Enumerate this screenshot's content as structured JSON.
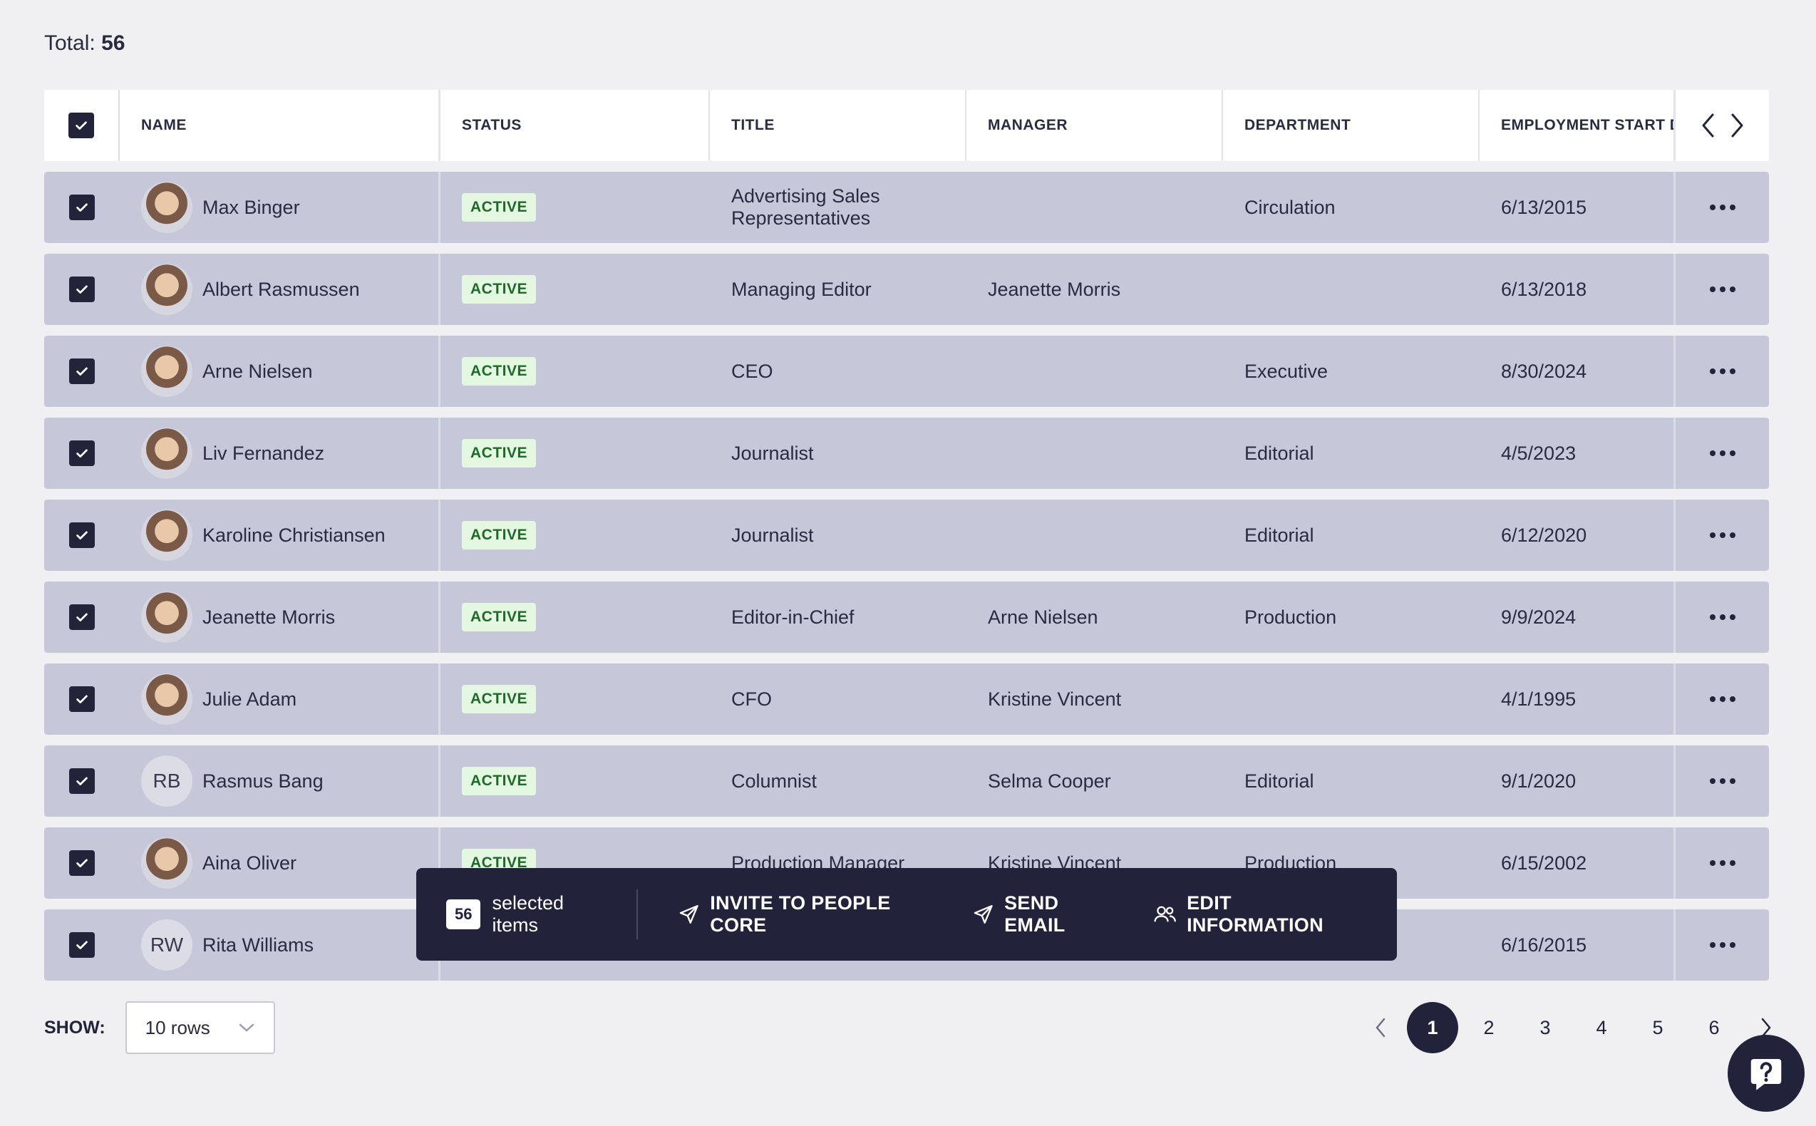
{
  "total": {
    "label": "Total:",
    "value": "56"
  },
  "table": {
    "headers": {
      "name": "NAME",
      "status": "STATUS",
      "title": "TITLE",
      "manager": "MANAGER",
      "department": "DEPARTMENT",
      "start_date": "EMPLOYMENT START D"
    },
    "rows": [
      {
        "name": "Max Binger",
        "avatar": "photo",
        "initials": "",
        "status": "ACTIVE",
        "title": "Advertising Sales Representatives",
        "manager": "",
        "department": "Circulation",
        "start_date": "6/13/2015"
      },
      {
        "name": "Albert Rasmussen",
        "avatar": "photo",
        "initials": "",
        "status": "ACTIVE",
        "title": "Managing Editor",
        "manager": "Jeanette Morris",
        "department": "",
        "start_date": "6/13/2018"
      },
      {
        "name": "Arne Nielsen",
        "avatar": "photo",
        "initials": "",
        "status": "ACTIVE",
        "title": "CEO",
        "manager": "",
        "department": "Executive",
        "start_date": "8/30/2024"
      },
      {
        "name": "Liv Fernandez",
        "avatar": "photo",
        "initials": "",
        "status": "ACTIVE",
        "title": "Journalist",
        "manager": "",
        "department": "Editorial",
        "start_date": "4/5/2023"
      },
      {
        "name": "Karoline Christiansen",
        "avatar": "photo",
        "initials": "",
        "status": "ACTIVE",
        "title": "Journalist",
        "manager": "",
        "department": "Editorial",
        "start_date": "6/12/2020"
      },
      {
        "name": "Jeanette Morris",
        "avatar": "photo",
        "initials": "",
        "status": "ACTIVE",
        "title": "Editor-in-Chief",
        "manager": "Arne Nielsen",
        "department": "Production",
        "start_date": "9/9/2024"
      },
      {
        "name": "Julie Adam",
        "avatar": "photo",
        "initials": "",
        "status": "ACTIVE",
        "title": "CFO",
        "manager": "Kristine Vincent",
        "department": "",
        "start_date": "4/1/1995"
      },
      {
        "name": "Rasmus Bang",
        "avatar": "initials",
        "initials": "RB",
        "status": "ACTIVE",
        "title": "Columnist",
        "manager": "Selma Cooper",
        "department": "Editorial",
        "start_date": "9/1/2020"
      },
      {
        "name": "Aina Oliver",
        "avatar": "photo",
        "initials": "",
        "status": "ACTIVE",
        "title": "Production Manager",
        "manager": "Kristine Vincent",
        "department": "Production",
        "start_date": "6/15/2002"
      },
      {
        "name": "Rita Williams",
        "avatar": "initials",
        "initials": "RW",
        "status": "",
        "title": "",
        "manager": "",
        "department": "",
        "start_date": "6/16/2015"
      }
    ]
  },
  "bulk_bar": {
    "count": "56",
    "selected_label": "selected items",
    "invite_label": "INVITE TO PEOPLE CORE",
    "email_label": "SEND EMAIL",
    "edit_label": "EDIT INFORMATION"
  },
  "footer": {
    "show_label": "SHOW:",
    "rows_value": "10 rows",
    "pages": [
      "1",
      "2",
      "3",
      "4",
      "5",
      "6"
    ],
    "current_page": "1"
  },
  "colors": {
    "row_bg": "#c7c7da",
    "header_bg": "#ffffff",
    "dark": "#22223a",
    "badge_bg": "#e4f7e1",
    "badge_text": "#1e6a2a",
    "page_bg": "#f0f0f3"
  },
  "icons": {
    "checkbox": "check-icon",
    "more": "more-horizontal-icon",
    "invite": "send-icon",
    "email": "send-icon",
    "edit": "users-icon",
    "dropdown": "chevron-down-icon",
    "help": "help-chat-icon"
  }
}
